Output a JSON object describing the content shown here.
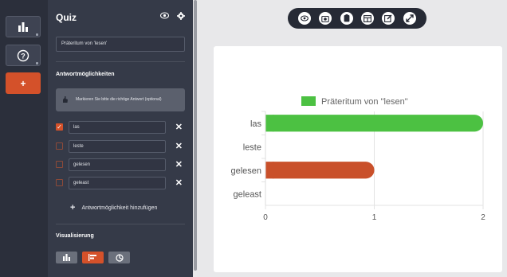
{
  "panel": {
    "title": "Quiz",
    "question_value": "Präteritum von 'lesen'",
    "answers_heading": "Antwortmöglichkeiten",
    "hint_text": "Markieren Sie bitte die richtige Antwort (optional)",
    "options": [
      {
        "label": "las",
        "checked": true
      },
      {
        "label": "leste",
        "checked": false
      },
      {
        "label": "gelesen",
        "checked": false
      },
      {
        "label": "geleast",
        "checked": false
      }
    ],
    "add_option_label": "Antwortmöglichkeit hinzufügen",
    "visualization_heading": "Visualisierung",
    "visualizations": [
      "column-chart",
      "bar-chart",
      "pie-chart"
    ],
    "active_visualization": "bar-chart"
  },
  "rail": {
    "add_label": "+"
  },
  "toolbar": {
    "buttons": [
      "eye",
      "camera",
      "clipboard",
      "table",
      "edit",
      "fullscreen"
    ]
  },
  "colors": {
    "accent": "#d4512a",
    "correct": "#4cc142",
    "wrong": "#c9502a",
    "panel": "#353a48",
    "rail": "#2b2f3b"
  },
  "chart_data": {
    "type": "bar",
    "orientation": "horizontal",
    "title": "",
    "categories": [
      "las",
      "leste",
      "gelesen",
      "geleast"
    ],
    "series": [
      {
        "name": "Präteritum von \"lesen\"",
        "values": [
          2,
          0,
          1,
          0
        ]
      }
    ],
    "bar_colors": [
      "#4cc142",
      null,
      "#c9502a",
      null
    ],
    "xlim": [
      0,
      2
    ],
    "xticks": [
      "0",
      "1",
      "2"
    ],
    "grid": true,
    "legend": "top"
  }
}
